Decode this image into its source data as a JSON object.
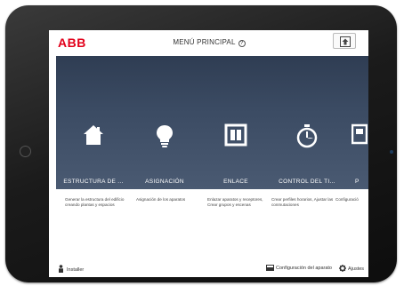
{
  "header": {
    "logo": "ABB",
    "title": "MENÚ PRINCIPAL",
    "help": "?"
  },
  "tiles": [
    {
      "label": "ESTRUCTURA DE ...",
      "icon": "house-icon",
      "description": "Generar la estructura del edificio creando plantas y espacios"
    },
    {
      "label": "ASIGNACIÓN",
      "icon": "lightbulb-icon",
      "description": "Asignación de los aparatos"
    },
    {
      "label": "ENLACE",
      "icon": "switch-icon",
      "description": "Enlazar aparatos y receptores, Crear grupos y escenas"
    },
    {
      "label": "CONTROL DEL TI...",
      "icon": "stopwatch-icon",
      "description": "Crear perfiles horarios, Ajustar las conmutaciones"
    },
    {
      "label": "P",
      "icon": "device-icon",
      "description": "Configuració"
    }
  ],
  "footer": {
    "installer": "Installer",
    "config": "Configuración del aparato",
    "settings": "Ajustes"
  },
  "colors": {
    "brand": "#e2001a",
    "panel": "#3b4b63"
  }
}
